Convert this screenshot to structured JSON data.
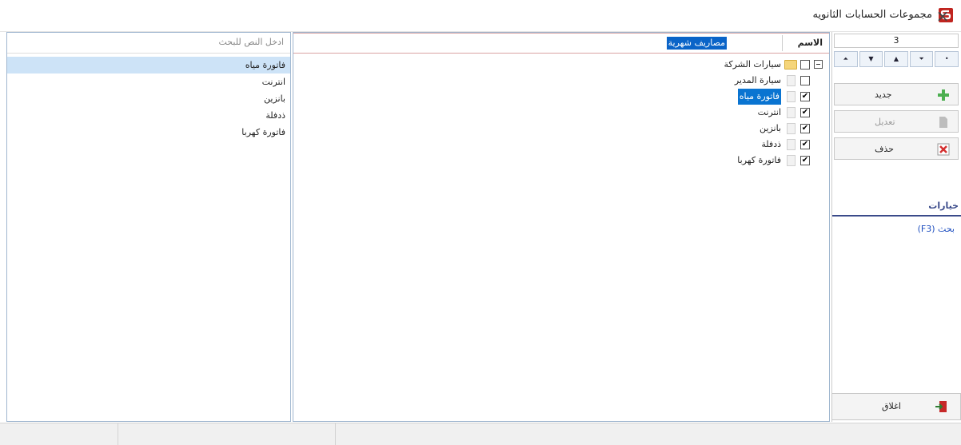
{
  "window": {
    "title": "مجموعات الحسابات الثانويه",
    "close_glyph": "×",
    "app_icon": "app-logo-icon"
  },
  "left": {
    "search_placeholder": "ادخل النص للبحث",
    "results": [
      "فاتورة مياه",
      "انترنت",
      "بانزين",
      "ذدفلة",
      "فاتورة كهربا"
    ],
    "selected_index": 0
  },
  "middle": {
    "name_label": "الاسم",
    "name_value": "مصاريف شهرية",
    "tree": {
      "group_label": "سيارات الشركة",
      "subgroup_label": "سيارة المدير",
      "items": [
        {
          "label": "فاتورة مياه",
          "checked": true,
          "selected": true
        },
        {
          "label": "انترنت",
          "checked": true,
          "selected": false
        },
        {
          "label": "بانزين",
          "checked": true,
          "selected": false
        },
        {
          "label": "ذدفلة",
          "checked": true,
          "selected": false
        },
        {
          "label": "فاتورة كهربا",
          "checked": true,
          "selected": false
        }
      ]
    },
    "check_glyph": "✔"
  },
  "right": {
    "record_count": "3",
    "nav": [
      "⏶",
      "▼",
      "▲",
      "⏷",
      "•"
    ],
    "buttons": {
      "new_label": "جديد",
      "edit_label": "تعديل",
      "delete_label": "حذف"
    },
    "options_header": "خيارات",
    "search_link": "بحث (F3)",
    "close_label": "اغلاق"
  },
  "colors": {
    "accent": "#0a74d1",
    "new_icon": "#4caf50",
    "delete_icon": "#d32f2f",
    "options_rule": "#3a4a8a"
  }
}
